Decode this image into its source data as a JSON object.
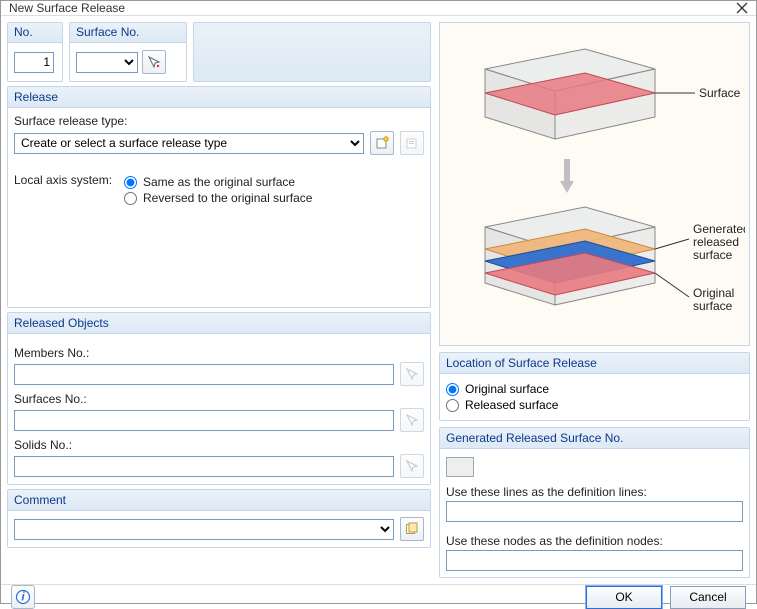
{
  "window": {
    "title": "New Surface Release"
  },
  "top": {
    "no_label": "No.",
    "no_value": "1",
    "surface_no_label": "Surface No.",
    "surface_no_value": ""
  },
  "release": {
    "header": "Release",
    "type_label": "Surface release type:",
    "type_placeholder": "Create or select a surface release type",
    "axis_label": "Local axis system:",
    "axis_same": "Same as the original surface",
    "axis_reversed": "Reversed to the original surface"
  },
  "released": {
    "header": "Released Objects",
    "members_label": "Members No.:",
    "surfaces_label": "Surfaces No.:",
    "solids_label": "Solids No.:",
    "members_value": "",
    "surfaces_value": "",
    "solids_value": ""
  },
  "comment": {
    "header": "Comment",
    "value": ""
  },
  "preview": {
    "label_surface": "Surface",
    "label_generated": "Generated\nreleased\nsurface",
    "label_original": "Original\nsurface"
  },
  "location": {
    "header": "Location of Surface Release",
    "opt_original": "Original surface",
    "opt_released": "Released surface"
  },
  "generated": {
    "header": "Generated Released Surface No.",
    "lines_label": "Use these lines as the definition lines:",
    "nodes_label": "Use these nodes as the definition nodes:",
    "lines_value": "",
    "nodes_value": ""
  },
  "footer": {
    "ok": "OK",
    "cancel": "Cancel"
  },
  "icons": {
    "pick": "pick-icon",
    "new": "new-icon",
    "edit": "edit-icon",
    "library": "library-icon",
    "help": "help-icon",
    "close": "close-icon"
  }
}
